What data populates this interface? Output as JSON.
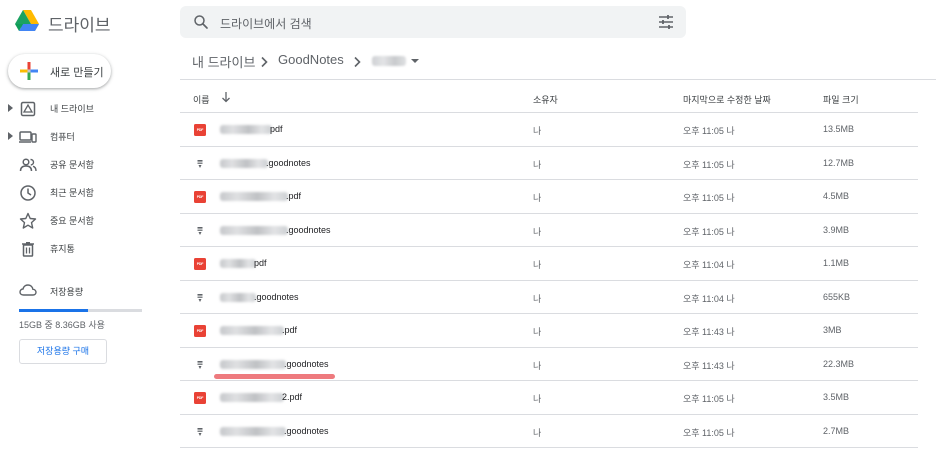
{
  "header": {
    "app_title": "드라이브",
    "search_placeholder": "드라이브에서 검색"
  },
  "sidebar": {
    "new_label": "새로 만들기",
    "items": [
      {
        "label": "내 드라이브",
        "icon": "my-drive-icon",
        "expandable": true
      },
      {
        "label": "컴퓨터",
        "icon": "computer-icon",
        "expandable": true
      },
      {
        "label": "공유 문서함",
        "icon": "shared-icon",
        "expandable": false
      },
      {
        "label": "최근 문서함",
        "icon": "clock-icon",
        "expandable": false
      },
      {
        "label": "중요 문서함",
        "icon": "star-icon",
        "expandable": false
      },
      {
        "label": "휴지통",
        "icon": "trash-icon",
        "expandable": false
      }
    ],
    "storage": {
      "label": "저장용량",
      "usage_text": "15GB 중 8.36GB 사용",
      "used_fraction": 0.557,
      "buy_label": "저장용량 구매"
    }
  },
  "breadcrumb": {
    "root": "내 드라이브",
    "folder": "GoodNotes"
  },
  "table": {
    "columns": {
      "name": "이름",
      "owner": "소유자",
      "modified": "마지막으로 수정한 날짜",
      "size": "파일 크기"
    },
    "rows": [
      {
        "type": "pdf",
        "suffix": "pdf",
        "owner": "나",
        "modified": "오후 11:05 나",
        "size": "13.5MB"
      },
      {
        "type": "goodnotes",
        "suffix": ".goodnotes",
        "owner": "나",
        "modified": "오후 11:05 나",
        "size": "12.7MB"
      },
      {
        "type": "pdf",
        "suffix": ".pdf",
        "owner": "나",
        "modified": "오후 11:05 나",
        "size": "4.5MB"
      },
      {
        "type": "goodnotes",
        "suffix": ".goodnotes",
        "owner": "나",
        "modified": "오후 11:05 나",
        "size": "3.9MB"
      },
      {
        "type": "pdf",
        "suffix": "pdf",
        "owner": "나",
        "modified": "오후 11:04 나",
        "size": "1.1MB"
      },
      {
        "type": "goodnotes",
        "suffix": ".goodnotes",
        "owner": "나",
        "modified": "오후 11:04 나",
        "size": "655KB"
      },
      {
        "type": "pdf",
        "suffix": ".pdf",
        "owner": "나",
        "modified": "오후 11:43 나",
        "size": "3MB"
      },
      {
        "type": "goodnotes",
        "suffix": ".goodnotes",
        "owner": "나",
        "modified": "오후 11:43 나",
        "size": "22.3MB"
      },
      {
        "type": "pdf",
        "suffix": "2.pdf",
        "owner": "나",
        "modified": "오후 11:05 나",
        "size": "3.5MB"
      },
      {
        "type": "goodnotes",
        "suffix": ".goodnotes",
        "owner": "나",
        "modified": "오후 11:05 나",
        "size": "2.7MB"
      }
    ]
  },
  "colors": {
    "accent": "#1a73e8",
    "pdf_red": "#e94235",
    "highlight": "#ee7a7e"
  },
  "pdf_badge_text": "PDF"
}
